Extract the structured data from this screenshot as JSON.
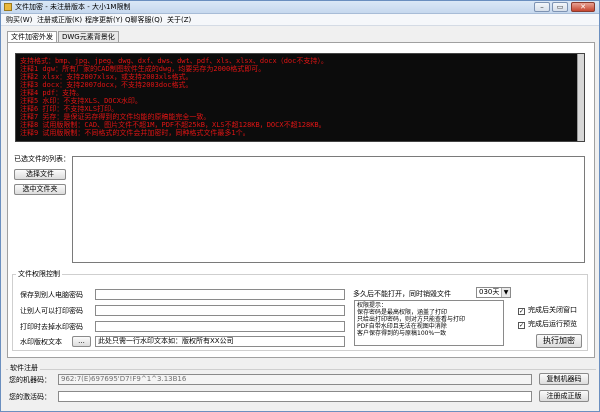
{
  "window": {
    "title": "文件加密 - 未注册版本 - 大小1M限制",
    "minimize_glyph": "–",
    "maximize_glyph": "▭",
    "close_glyph": "✕"
  },
  "menu": {
    "items": [
      "购买(W)",
      "注册或正版(K)",
      "程序更新(Y)",
      "Q聊客服(Q)",
      "关于(Z)"
    ]
  },
  "tabs": [
    "文件加密外发",
    "DWG元素背景化"
  ],
  "console": {
    "lines": [
      "支持格式：bmp、jpg、jpeg、dwg、dxf、dws、dwt、pdf、xls、xlsx、docx（doc不支持）。",
      "注释1 dgw：所有厂家的CAD制图软件生成的dwg，均要另存为2000格式即可。",
      "注释2 xlsx：支持2007xlsx，或支持2003xls格式。",
      "注释3 docx：支持2007docx，不支持2003doc格式。",
      "注释4 pdf：支持。",
      "注释5 水印：不支持XLS、DOCX水印。",
      "注释6 打印：不支持XLS打印。",
      "注释7 另存：是保证另存得到的文件均能的原稿能完全一致。",
      "注释8 试用版限制：CAD、图片文件不超1M，PDF不超25kB，XLS不超128KB，DOCX不超128KB。",
      "注释9 试用版限制：不同格式的文件会并加密时，同种格式文件最多1个。"
    ]
  },
  "files": {
    "label": "已选文件的列表：",
    "select_file_label": "选择文件",
    "select_folder_label": "选中文件夹"
  },
  "permissions": {
    "group_label": "文件权限控制",
    "save_password_label": "保存到别人电脑密码",
    "print_password_label": "让别人可以打印密码",
    "remove_watermark_label": "打印时去掉水印密码",
    "watermark_label": "水印版权文本",
    "watermark_browse_label": "...",
    "watermark_value": "此处只需一行水印文本如：版权所有XX公司",
    "expiry_label": "多久后不能打开，同时销毁文件",
    "expiry_value": "030天",
    "hint_lines": [
      "权限提示：",
      "保存密码是最高权限，涵盖了打印",
      "只给出打印密码，则对方只能查看与打印",
      "PDF自带水印且无法在视图中消除",
      "客户保存得到的与原稿100%一致"
    ],
    "close_after_label": "完成后关闭窗口",
    "close_after_checked": true,
    "preview_after_label": "完成后运行预览",
    "preview_after_checked": true,
    "encrypt_label": "执行加密"
  },
  "registration": {
    "group_label": "软件注册",
    "machine_code_label": "您的机器码：",
    "machine_code_value": "962:7(E)697695'D7!F9^1^3.13B16",
    "copy_machine_code_label": "复制机器码",
    "activation_code_label": "您的激活码：",
    "activation_code_value": "",
    "register_label": "注册成正版"
  },
  "colors": {
    "console_background": "#0c0c0c",
    "console_text": "#e11414",
    "title_bar": "#c6d8ee"
  }
}
